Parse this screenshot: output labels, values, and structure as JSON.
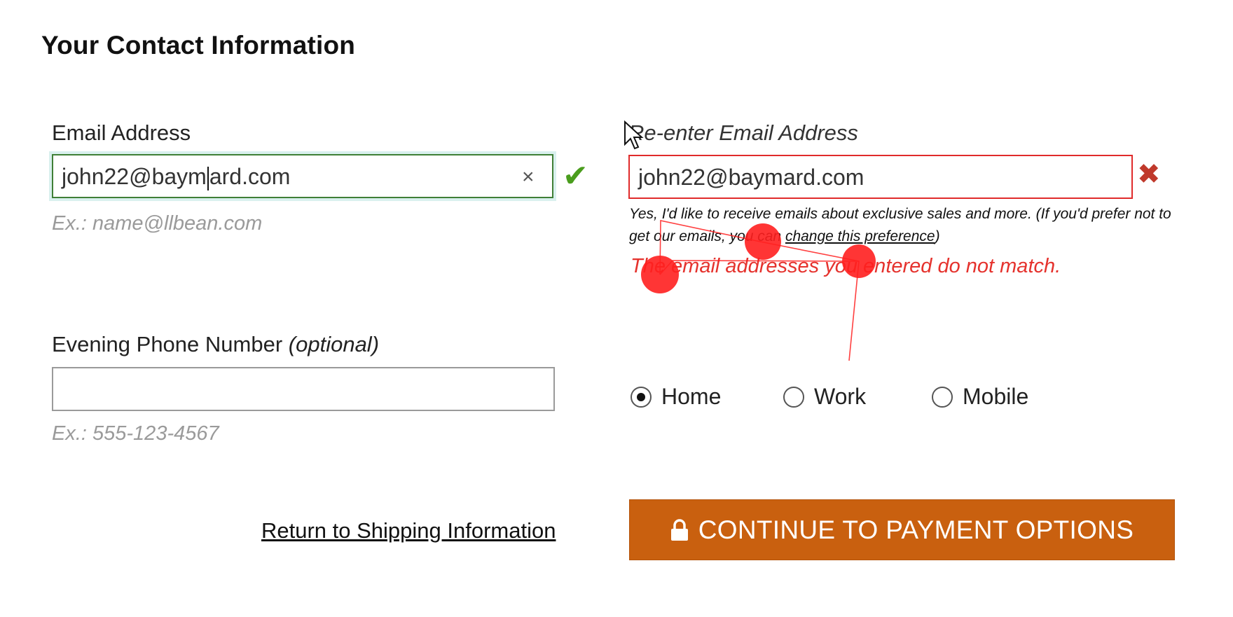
{
  "header": {
    "title": "Your Contact Information"
  },
  "email": {
    "label": "Email Address",
    "value_before_caret": "john22@baym",
    "value_after_caret": "ard.com",
    "clear_label": "×",
    "hint": "Ex.: name@llbean.com",
    "valid_icon": "check-icon"
  },
  "email_confirm": {
    "label": "Re-enter Email Address",
    "value": "john22@baymard.com",
    "invalid_icon": "x-icon",
    "newsletter_text": "Yes, I'd like to receive emails about exclusive sales and more. (If you'd prefer not to get our emails, you can ",
    "newsletter_link": "change this preference",
    "newsletter_end": ")",
    "error": "The email addresses you entered do not match."
  },
  "phone": {
    "label": "Evening Phone Number",
    "label_optional": "(optional)",
    "value": "",
    "hint": "Ex.: 555-123-4567",
    "types": [
      {
        "label": "Home",
        "selected": true
      },
      {
        "label": "Work",
        "selected": false
      },
      {
        "label": "Mobile",
        "selected": false
      }
    ]
  },
  "actions": {
    "back_link": "Return to Shipping Information",
    "continue_label": "CONTINUE TO PAYMENT OPTIONS",
    "continue_icon": "lock-icon"
  },
  "colors": {
    "valid": "#4a9d1d",
    "error": "#e5322d",
    "cta": "#c9600f",
    "gaze_marker": "#ff1f1f"
  }
}
